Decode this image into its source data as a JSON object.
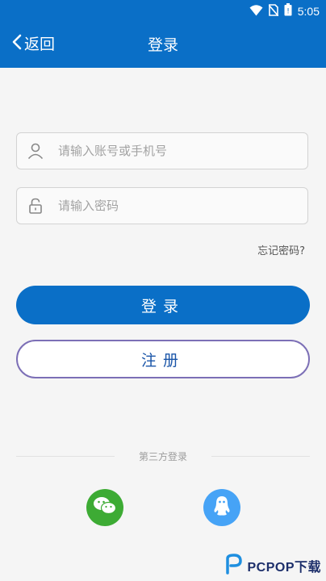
{
  "status_bar": {
    "time": "5:05",
    "icons": [
      "wifi-icon",
      "no-sim-icon",
      "battery-icon"
    ]
  },
  "header": {
    "back_label": "返回",
    "title": "登录"
  },
  "form": {
    "account_placeholder": "请输入账号或手机号",
    "password_placeholder": "请输入密码",
    "forgot_label": "忘记密码?"
  },
  "buttons": {
    "login_label": "登录",
    "register_label": "注册"
  },
  "third_party": {
    "label": "第三方登录",
    "providers": [
      "wechat-icon",
      "qq-icon"
    ]
  },
  "watermark": {
    "text": "PCPOP",
    "suffix": "下载"
  },
  "colors": {
    "primary": "#0a6fc7",
    "register_border": "#7c6fb6",
    "wechat": "#3dab34",
    "qq": "#46a3f6"
  }
}
